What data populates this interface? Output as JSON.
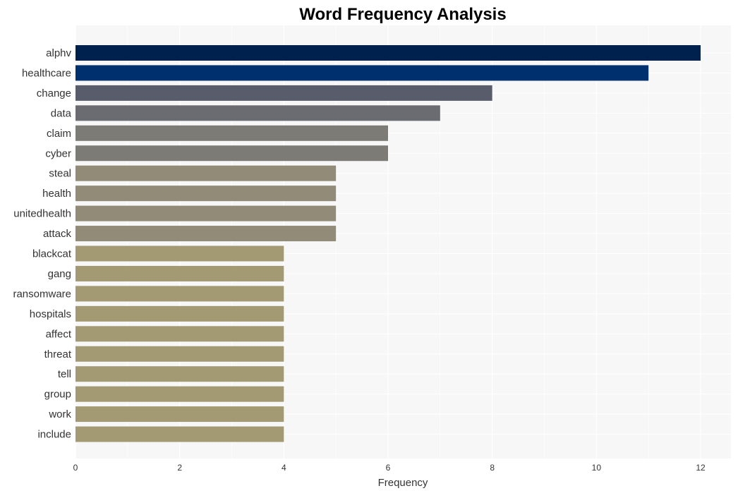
{
  "chart_data": {
    "type": "bar",
    "orientation": "horizontal",
    "title": "Word Frequency Analysis",
    "xlabel": "Frequency",
    "ylabel": "",
    "xlim": [
      0,
      12.6
    ],
    "xticks": [
      0,
      2,
      4,
      6,
      8,
      10,
      12
    ],
    "grid": true,
    "legend": "none",
    "categories": [
      "alphv",
      "healthcare",
      "change",
      "data",
      "claim",
      "cyber",
      "steal",
      "health",
      "unitedhealth",
      "attack",
      "blackcat",
      "gang",
      "ransomware",
      "hospitals",
      "affect",
      "threat",
      "tell",
      "group",
      "work",
      "include"
    ],
    "values": [
      12,
      11,
      8,
      7,
      6,
      6,
      5,
      5,
      5,
      5,
      4,
      4,
      4,
      4,
      4,
      4,
      4,
      4,
      4,
      4
    ],
    "colors": [
      "#00214d",
      "#00306e",
      "#595c6b",
      "#6b6c72",
      "#7c7b76",
      "#7c7b76",
      "#928b77",
      "#928b77",
      "#928b77",
      "#928b77",
      "#a39a73",
      "#a39a73",
      "#a39a73",
      "#a39a73",
      "#a39a73",
      "#a39a73",
      "#a39a73",
      "#a39a73",
      "#a39a73",
      "#a39a73"
    ],
    "background": "#f7f7f7"
  }
}
